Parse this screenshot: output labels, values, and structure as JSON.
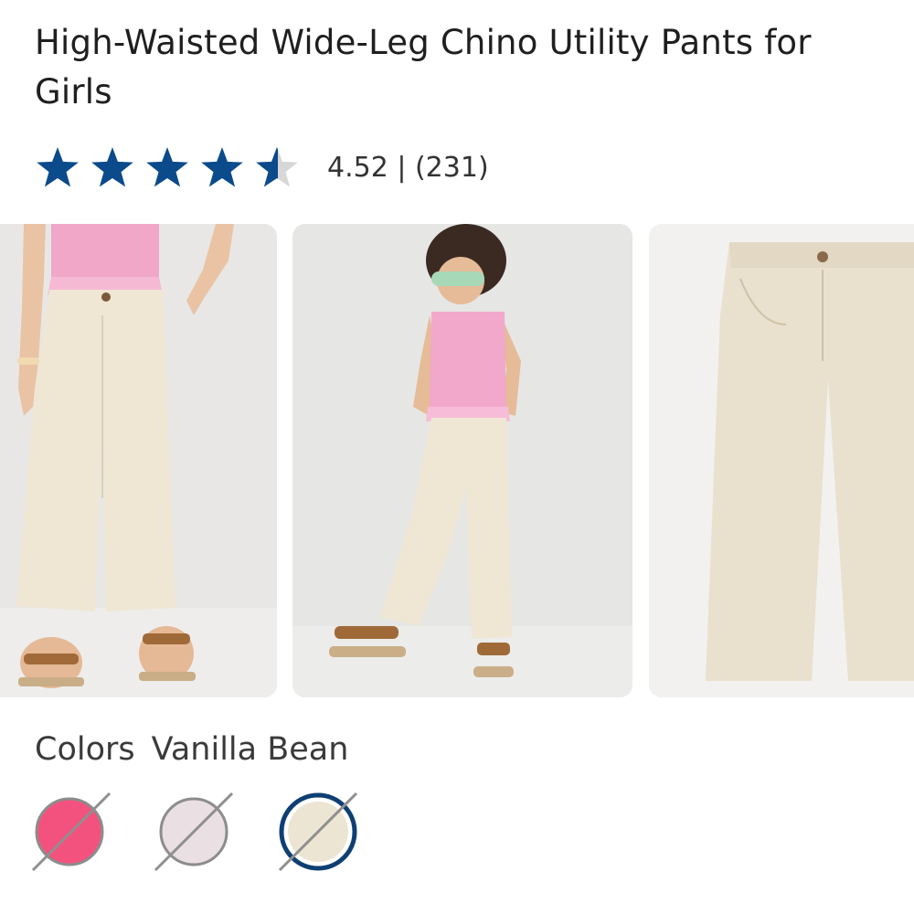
{
  "product": {
    "title": "High-Waisted Wide-Leg Chino Utility Pants for Girls",
    "rating_value": 4.52,
    "rating_text": "4.52 | (231)",
    "review_count": 231,
    "star_color": "#0b4a8b"
  },
  "gallery": {
    "images": [
      {
        "name": "model-front-crop"
      },
      {
        "name": "model-full-body"
      },
      {
        "name": "product-flat-lay"
      }
    ]
  },
  "colors": {
    "label": "Colors",
    "selected_name": "Vanilla Bean",
    "swatches": [
      {
        "name": "pink",
        "color": "#f4527e",
        "selected": false,
        "unavailable": true
      },
      {
        "name": "light-pink",
        "color": "#eadfe3",
        "selected": false,
        "unavailable": true
      },
      {
        "name": "vanilla-bean",
        "color": "#ede5d3",
        "selected": true,
        "unavailable": true
      }
    ],
    "selected_ring_color": "#0e3f73"
  }
}
